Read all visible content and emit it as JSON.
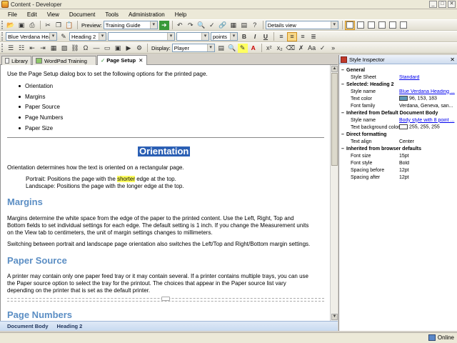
{
  "window": {
    "title": "Content - Developer",
    "controls": [
      "_",
      "□",
      "✕"
    ]
  },
  "menu": [
    "File",
    "Edit",
    "View",
    "Document",
    "Tools",
    "Administration",
    "Help"
  ],
  "toolbar1": {
    "preview_label": "Preview:",
    "preview_value": "Training Guide",
    "view_value": "Details view"
  },
  "toolbar2": {
    "style_value": "Blue Verdana Headi...",
    "heading_value": "Heading 2",
    "font_value": "",
    "size_value": "",
    "units_value": "points",
    "bold": "B",
    "italic": "I",
    "underline": "U"
  },
  "toolbar3": {
    "display_label": "Display:",
    "display_value": "Player",
    "sup": "x²",
    "sub": "x₂"
  },
  "tabs": [
    {
      "label": "Library"
    },
    {
      "label": "WordPad Training"
    },
    {
      "label": "Page Setup",
      "close": "✕"
    }
  ],
  "doc": {
    "intro": "Use the Page Setup dialog box to set the following options for the printed page.",
    "bullets": [
      "Orientation",
      "Margins",
      "Paper Source",
      "Page Numbers",
      "Paper Size"
    ],
    "orientation_heading": "Orientation",
    "orientation_text": "Orientation determines how the text is oriented on a rectangular page.",
    "portrait_pre": "Portrait: Positions the page with the ",
    "portrait_hl": "shorter",
    "portrait_post": " edge at the top.",
    "landscape": "Landscape: Positions the page with the longer edge at the top.",
    "margins_heading": "Margins",
    "margins_text1": "Margins determine the white space from the edge of the paper to the printed content. Use the Left, Right, Top and",
    "margins_text2": "Bottom fields to set individual settings for each edge. The default setting is 1 inch. If you change the Measurement units",
    "margins_text3": "on the View tab to centimeters, the unit of margin settings changes to millimeters.",
    "margins_text4": "Switching between portrait and landscape page orientation also switches the Left/Top and Right/Bottom margin settings.",
    "paper_heading": "Paper Source",
    "paper_text1": "A printer may contain only one paper feed tray or it may contain several. If a printer contains multiple trays, you can use",
    "paper_text2": "the Paper source option to select the tray for the printout. The choices that appear in the Paper source list vary",
    "paper_text3": "depending on the printer that is set as the default printer.",
    "pagenum_heading": "Page Numbers"
  },
  "doc_status": [
    "Document Body",
    "Heading 2"
  ],
  "inspector": {
    "title": "Style Inspector",
    "close": "✕",
    "rows": [
      {
        "type": "sec",
        "label": "General"
      },
      {
        "type": "kv",
        "key": "Style Sheet",
        "value": "Standard",
        "link": true
      },
      {
        "type": "sec",
        "label": "Selected: Heading 2"
      },
      {
        "type": "kv",
        "key": "Style name",
        "value": "Blue Verdana Heading ...",
        "link": true
      },
      {
        "type": "kv",
        "key": "Text color",
        "value": "96, 153, 183",
        "swatch": "#6099b7"
      },
      {
        "type": "kv",
        "key": "Font family",
        "value": "Verdana, Geneva, san..."
      },
      {
        "type": "sec",
        "label": "Inherited from Default Document Body"
      },
      {
        "type": "kv",
        "key": "Style name",
        "value": "Body style with 8 point ...",
        "link": true
      },
      {
        "type": "kv",
        "key": "Text background color",
        "value": "255, 255, 255",
        "swatch": "#ffffff"
      },
      {
        "type": "sec",
        "label": "Direct formatting"
      },
      {
        "type": "kv",
        "key": "Text align",
        "value": "Center"
      },
      {
        "type": "sec",
        "label": "Inherited from browser defaults"
      },
      {
        "type": "kv",
        "key": "Font size",
        "value": "15pt"
      },
      {
        "type": "kv",
        "key": "Font style",
        "value": "Bold"
      },
      {
        "type": "kv",
        "key": "Spacing before",
        "value": "12pt"
      },
      {
        "type": "kv",
        "key": "Spacing after",
        "value": "12pt"
      }
    ]
  },
  "status": {
    "online": "Online"
  },
  "colors": {
    "heading": "#5b8ec4",
    "selection": "#2b5fb4",
    "highlight": "#ffff60"
  }
}
